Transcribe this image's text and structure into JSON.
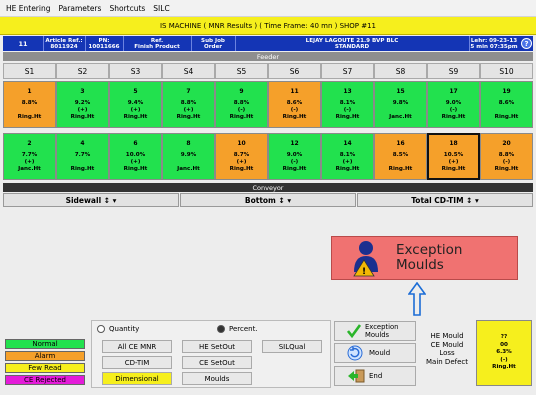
{
  "menu": [
    "HE Entering",
    "Parameters",
    "Shortcuts",
    "SILC"
  ],
  "title": "IS MACHINE ( MNR Results ) ( Time Frame: 40 mn ) SHOP #11",
  "infobar": {
    "line_num": "11",
    "article_label": "Article Ref.:",
    "article_val": "8011924",
    "pn_label": "PN:",
    "pn_val": "10011666",
    "ref_label": "Ref.",
    "ref_val": "Finish Product",
    "subjob_label": "Sub Job",
    "subjob_val": "Order",
    "product_line1": "LEJAY LAGOUTE 21.9 BVP BLC",
    "product_line2": "STANDARD",
    "lehr_label": "Lehr: 09-23-13",
    "lehr_val": "5 min 07:35pm"
  },
  "feeder_label": "Feeder",
  "sections": [
    "S1",
    "S2",
    "S3",
    "S4",
    "S5",
    "S6",
    "S7",
    "S8",
    "S9",
    "S10"
  ],
  "moulds_top": [
    {
      "num": "1",
      "pct": "8.8%",
      "sign": "",
      "name": "Ring.Ht",
      "color": "orange"
    },
    {
      "num": "3",
      "pct": "9.2%",
      "sign": "(+)",
      "name": "Ring.Ht",
      "color": "green"
    },
    {
      "num": "5",
      "pct": "9.4%",
      "sign": "(+)",
      "name": "Ring.Ht",
      "color": "green"
    },
    {
      "num": "7",
      "pct": "8.8%",
      "sign": "(+)",
      "name": "Ring.Ht",
      "color": "green"
    },
    {
      "num": "9",
      "pct": "8.8%",
      "sign": "(-)",
      "name": "Ring.Ht",
      "color": "green"
    },
    {
      "num": "11",
      "pct": "8.6%",
      "sign": "(-)",
      "name": "Ring.Ht",
      "color": "orange"
    },
    {
      "num": "13",
      "pct": "8.1%",
      "sign": "(-)",
      "name": "Ring.Ht",
      "color": "green"
    },
    {
      "num": "15",
      "pct": "9.8%",
      "sign": "",
      "name": "Janc.Ht",
      "color": "green"
    },
    {
      "num": "17",
      "pct": "9.0%",
      "sign": "(-)",
      "name": "Ring.Ht",
      "color": "green"
    },
    {
      "num": "19",
      "pct": "8.6%",
      "sign": "",
      "name": "Ring.Ht",
      "color": "green"
    }
  ],
  "moulds_bottom": [
    {
      "num": "2",
      "pct": "7.7%",
      "sign": "(+)",
      "name": "Janc.Ht",
      "color": "green"
    },
    {
      "num": "4",
      "pct": "7.7%",
      "sign": "",
      "name": "Ring.Ht",
      "color": "green"
    },
    {
      "num": "6",
      "pct": "10.0%",
      "sign": "(+)",
      "name": "Ring.Ht",
      "color": "green"
    },
    {
      "num": "8",
      "pct": "9.9%",
      "sign": "",
      "name": "Janc.Ht",
      "color": "green"
    },
    {
      "num": "10",
      "pct": "8.7%",
      "sign": "(+)",
      "name": "Ring.Ht",
      "color": "orange"
    },
    {
      "num": "12",
      "pct": "9.0%",
      "sign": "(-)",
      "name": "Ring.Ht",
      "color": "green"
    },
    {
      "num": "14",
      "pct": "8.1%",
      "sign": "(+)",
      "name": "Ring.Ht",
      "color": "green"
    },
    {
      "num": "16",
      "pct": "8.5%",
      "sign": "",
      "name": "Ring.Ht",
      "color": "orange"
    },
    {
      "num": "18",
      "pct": "10.5%",
      "sign": "(+)",
      "name": "Ring.Ht",
      "color": "orange",
      "selected": true
    },
    {
      "num": "20",
      "pct": "8.8%",
      "sign": "(-)",
      "name": "Ring.Ht",
      "color": "orange"
    }
  ],
  "conveyor_label": "Conveyor",
  "selectors": {
    "sidewall": "Sidewall ↕ ▾",
    "bottom": "Bottom ↕ ▾",
    "total": "Total CD-TIM ↕ ▾"
  },
  "exception": {
    "line1": "Exception",
    "line2": "Moulds"
  },
  "legend": [
    {
      "label": "Normal",
      "color": "#22e14e"
    },
    {
      "label": "Alarm",
      "color": "#f5a02a"
    },
    {
      "label": "Few Read",
      "color": "#f6ef1d"
    },
    {
      "label": "CE Rejected",
      "color": "#e41bd9"
    }
  ],
  "radios": {
    "quantity": "Quantity",
    "percent": "Percent."
  },
  "buttons": {
    "all_ce_mnr": "All CE MNR",
    "he_setout": "HE SetOut",
    "silqual": "SILQual",
    "cd_tim": "CD-TIM",
    "ce_setout": "CE SetOut",
    "dimensional": "Dimensional",
    "moulds": "Moulds"
  },
  "right_buttons": {
    "exception_moulds": "Exception\nMoulds",
    "mould": "Mould",
    "end": "End"
  },
  "info_labels": [
    "HE Mould",
    "CE Mould",
    "Loss",
    "Main Defect"
  ],
  "ybox": {
    "l1": "??",
    "l2": "00",
    "l3": "6.3%",
    "l4": "(-)",
    "l5": "Ring.Ht"
  },
  "colors": {
    "green": "#22e14e",
    "orange": "#f5a02a",
    "yellow": "#f6ef1d",
    "blue": "#1435b5"
  }
}
